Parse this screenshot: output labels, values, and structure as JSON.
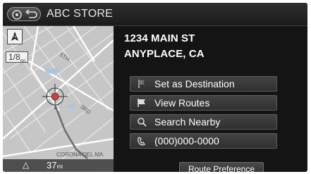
{
  "header": {
    "title": "ABC STORE",
    "back_icon": "back-arrow-icon"
  },
  "map": {
    "heading_icon": "north-up-icon",
    "scale_value": "1/8",
    "scale_unit": "mi",
    "streets": {
      "s1": "5TH",
      "s2": "3RD",
      "s3": "CORONA DEL MA"
    },
    "bottom_bar": {
      "distance": "37",
      "unit": "mi"
    }
  },
  "address": {
    "line1": "1234 MAIN ST",
    "line2": "ANYPLACE, CA"
  },
  "menu": [
    {
      "label": "Set as Destination",
      "icon": "flag-icon"
    },
    {
      "label": "View Routes",
      "icon": "route-flag-icon"
    },
    {
      "label": "Search Nearby",
      "icon": "search-nearby-icon"
    },
    {
      "label": "(000)000-0000",
      "icon": "phone-icon"
    }
  ],
  "route_preference": {
    "label": "Route Preference"
  }
}
